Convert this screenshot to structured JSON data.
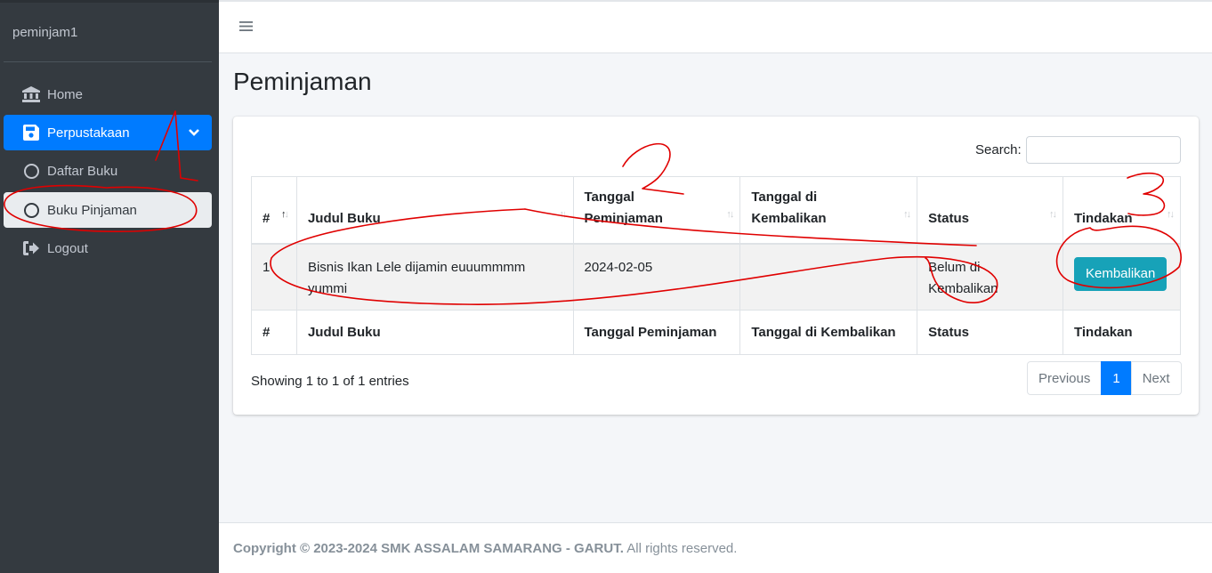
{
  "sidebar": {
    "brand": "peminjam1",
    "items": [
      {
        "label": "Home",
        "icon": "bank-icon"
      },
      {
        "label": "Perpustakaan",
        "icon": "save-icon",
        "active": true
      },
      {
        "label": "Daftar Buku",
        "icon": "circle-icon"
      },
      {
        "label": "Buku Pinjaman",
        "icon": "circle-icon",
        "selected": true
      },
      {
        "label": "Logout",
        "icon": "sign-out-icon"
      }
    ]
  },
  "page": {
    "title": "Peminjaman"
  },
  "search": {
    "label": "Search:",
    "value": ""
  },
  "table": {
    "headers": [
      "#",
      "Judul Buku",
      "Tanggal Peminjaman",
      "Tanggal di Kembalikan",
      "Status",
      "Tindakan"
    ],
    "header_lines": {
      "tanggal_pinjam_1": "Tanggal",
      "tanggal_pinjam_2": "Peminjaman",
      "tanggal_kembali_1": "Tanggal di",
      "tanggal_kembali_2": "Kembalikan"
    },
    "rows": [
      {
        "no": "1",
        "judul": "Bisnis Ikan Lele dijamin euuummmm yummi",
        "tanggal_pinjam": "2024-02-05",
        "tanggal_kembali": "",
        "status": "Belum di Kembalikan",
        "action": "Kembalikan"
      }
    ]
  },
  "info": "Showing 1 to 1 of 1 entries",
  "pagination": {
    "previous": "Previous",
    "current": "1",
    "next": "Next"
  },
  "footer": {
    "copyright": "Copyright © 2023-2024 SMK ASSALAM SAMARANG - GARUT.",
    "rights": " All rights reserved."
  },
  "annotations": [
    "1",
    "2",
    "3"
  ],
  "colors": {
    "sidebar": "#343a40",
    "primary": "#007bff",
    "info": "#17a2b8",
    "annotation": "#e00000"
  }
}
